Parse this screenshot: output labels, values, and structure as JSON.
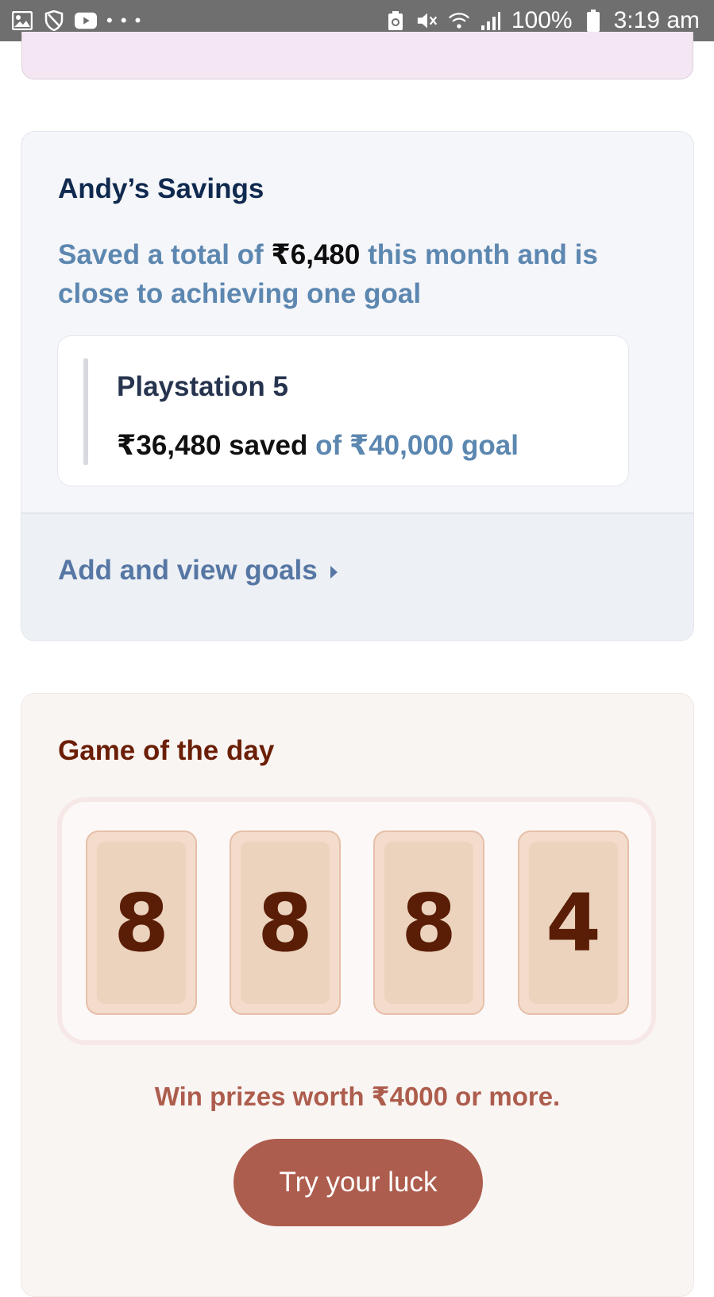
{
  "status_bar": {
    "dots": "• • •",
    "battery": "100%",
    "time": "3:19 am"
  },
  "savings": {
    "title": "Andy’s Savings",
    "desc_prefix": "Saved a total of ",
    "desc_amount": "₹6,480",
    "desc_suffix": " this month and is close to achieving one goal",
    "goal": {
      "name": "Playstation 5",
      "saved": "₹36,480 saved",
      "of": " of ₹40,000 goal"
    },
    "link_label": "Add and view goals"
  },
  "game": {
    "title": "Game of the day",
    "digits": [
      "8",
      "8",
      "8",
      "4"
    ],
    "prize_text": "Win prizes worth ₹4000 or more.",
    "button_label": "Try your luck"
  },
  "colors": {
    "status_bar": "#6f6f6f",
    "savings_title": "#102a4f",
    "savings_accent": "#5c87b0",
    "game_title": "#6b1e06",
    "game_button": "#ad5d4d"
  }
}
